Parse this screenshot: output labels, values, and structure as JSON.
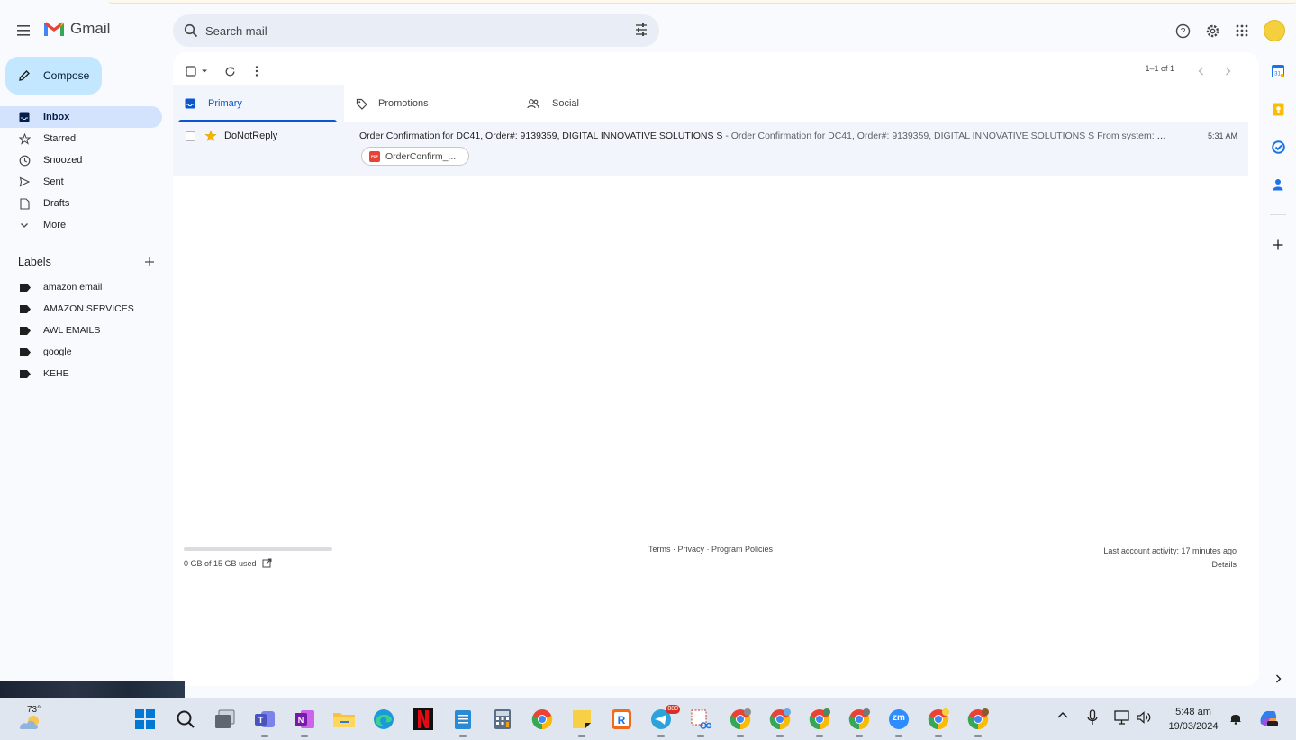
{
  "app": {
    "name": "Gmail"
  },
  "search": {
    "placeholder": "Search mail"
  },
  "compose": {
    "label": "Compose"
  },
  "nav": [
    {
      "label": "Inbox",
      "icon": "inbox-icon"
    },
    {
      "label": "Starred",
      "icon": "star-icon"
    },
    {
      "label": "Snoozed",
      "icon": "clock-icon"
    },
    {
      "label": "Sent",
      "icon": "send-icon"
    },
    {
      "label": "Drafts",
      "icon": "draft-icon"
    },
    {
      "label": "More",
      "icon": "chevron-down-icon"
    }
  ],
  "labels": {
    "title": "Labels",
    "items": [
      "amazon email",
      "AMAZON SERVICES",
      "AWL EMAILS",
      "google",
      "KEHE"
    ]
  },
  "pager": {
    "text": "1–1 of 1"
  },
  "tabs": [
    {
      "label": "Primary"
    },
    {
      "label": "Promotions"
    },
    {
      "label": "Social"
    }
  ],
  "emails": [
    {
      "sender": "DoNotReply",
      "subject": "Order Confirmation for DC41, Order#: 9139359, DIGITAL INNOVATIVE SOLUTIONS S",
      "snippet": " - Order Confirmation for DC41, Order#: 9139359, DIGITAL INNOVATIVE SOLUTIONS S From system: TOLS...",
      "time": "5:31 AM",
      "attachment": "OrderConfirm_...",
      "attachment_type": "PDF"
    }
  ],
  "footer": {
    "storage": "0 GB of 15 GB used",
    "storage_fraction": 0.0,
    "links": [
      "Terms",
      "Privacy",
      "Program Policies"
    ],
    "separator": " · ",
    "activity": "Last account activity: 17 minutes ago",
    "details": "Details"
  },
  "taskbar": {
    "temperature": "73°",
    "time": "5:48 am",
    "date": "19/03/2024",
    "telegram_badge": "880",
    "zoom_label": "zm"
  },
  "colors": {
    "accent": "#0b57d0",
    "compose_bg": "#c2e7ff",
    "active_nav": "#d3e3fd",
    "gmail_red": "#ea4335",
    "star": "#f4b400"
  }
}
